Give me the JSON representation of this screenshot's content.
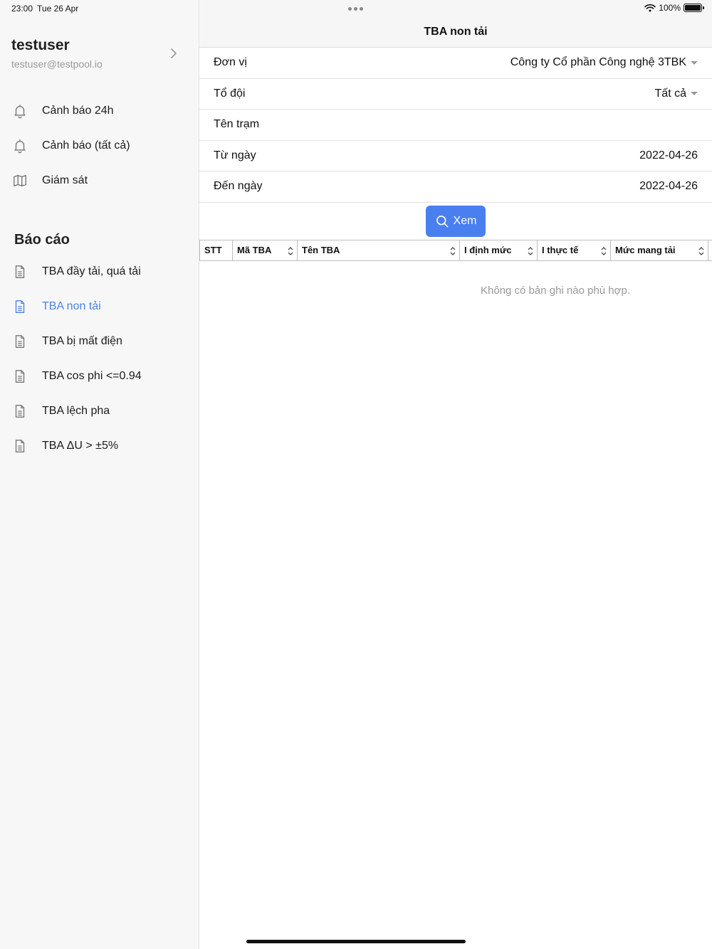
{
  "status_bar": {
    "time": "23:00",
    "date": "Tue 26 Apr",
    "battery": "100%"
  },
  "sidebar": {
    "user_name": "testuser",
    "user_email": "testuser@testpool.io",
    "menu": [
      {
        "label": "Cảnh báo 24h",
        "icon": "bell-icon"
      },
      {
        "label": "Cảnh báo (tất cả)",
        "icon": "bell-icon"
      },
      {
        "label": "Giám sát",
        "icon": "map-icon"
      }
    ],
    "report_section_title": "Báo cáo",
    "reports": [
      {
        "label": "TBA đầy tải, quá tải",
        "icon": "document-icon"
      },
      {
        "label": "TBA non tải",
        "icon": "document-icon",
        "active": true
      },
      {
        "label": "TBA bị mất điện",
        "icon": "document-icon"
      },
      {
        "label": "TBA cos phi <=0.94",
        "icon": "document-icon"
      },
      {
        "label": "TBA lệch pha",
        "icon": "document-icon"
      },
      {
        "label": "TBA ΔU > ±5%",
        "icon": "document-icon"
      }
    ],
    "active_color": "#4c82e8"
  },
  "main": {
    "title": "TBA non tải",
    "form": {
      "unit_label": "Đơn vị",
      "unit_value": "Công ty Cổ phần Công nghệ 3TBK",
      "team_label": "Tổ đội",
      "team_value": "Tất cả",
      "station_label": "Tên trạm",
      "station_value": "",
      "from_label": "Từ ngày",
      "from_value": "2022-04-26",
      "to_label": "Đến ngày",
      "to_value": "2022-04-26"
    },
    "view_button": "Xem",
    "button_color": "#4a7ff0",
    "table": {
      "columns": [
        "STT",
        "Mã TBA",
        "Tên TBA",
        "I định mức",
        "I thực tế",
        "Mức mang tải"
      ],
      "empty_message": "Không có bản ghi nào phù hợp."
    }
  }
}
